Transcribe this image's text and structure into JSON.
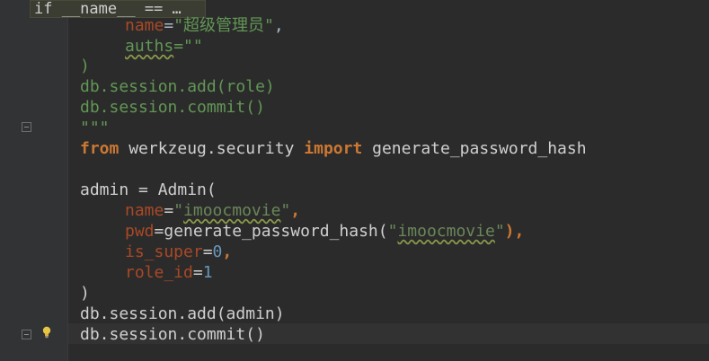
{
  "breadcrumb": "if __name__ == …",
  "code": {
    "l1": {
      "name_kw": "name",
      "eq": "=",
      "str": "\"超级管理员\"",
      "comma": ","
    },
    "l2": {
      "auths_kw": "auths",
      "eq": "=",
      "str": "\"\""
    },
    "l3": ")",
    "l4": "db.session.add(role)",
    "l5": "db.session.commit()",
    "l6": "\"\"\"",
    "l7": {
      "from": "from",
      "module": " werkzeug.security ",
      "import": "import",
      "name": " generate_password_hash"
    },
    "l8": {
      "left": "admin = Admin("
    },
    "l9": {
      "kw": "name",
      "eq": "=",
      "q1": "\"",
      "val": "imoocmovie",
      "q2": "\"",
      "comma": ","
    },
    "l10": {
      "kw": "pwd",
      "eq": "=",
      "fn": "generate_password_hash(",
      "q1": "\"",
      "val": "imoocmovie",
      "q2": "\"",
      "close": "),"
    },
    "l11": {
      "kw": "is_super",
      "eq": "=",
      "num": "0",
      "comma": ","
    },
    "l12": {
      "kw": "role_id",
      "eq": "=",
      "num": "1"
    },
    "l13": ")",
    "l14": "db.session.add(admin)",
    "l15": "db.session.commit()"
  },
  "colors": {
    "background": "#2b2b2b",
    "keyword": "#cc7832",
    "param": "#aa4926",
    "string": "#6a8759",
    "number": "#6897bb",
    "bulb": "#e8c547"
  },
  "icons": [
    "fold-icon",
    "lightbulb-icon"
  ]
}
